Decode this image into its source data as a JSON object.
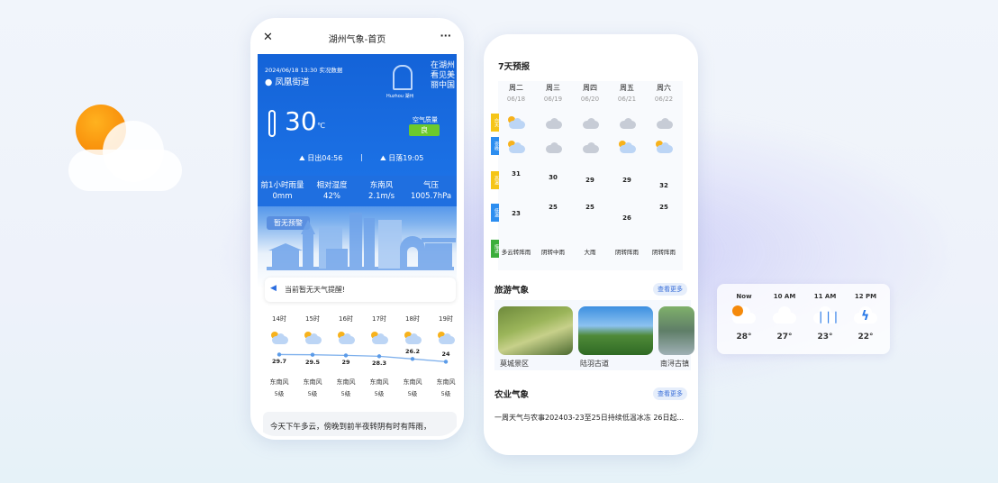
{
  "phone1": {
    "title": "湖州气象-首页",
    "close_icon": "close-icon",
    "more_icon": "more-icon",
    "timestamp": "2024/06/18 13:30 实况数据",
    "location": "凤凰街道",
    "logo_text": "Huzhou 湖州",
    "temperature": "30",
    "temp_unit": "℃",
    "aqi_label": "空气质量",
    "aqi_value": "良",
    "aqi_color": "#6cc92c",
    "sunrise": "日出04:56",
    "sunset": "日落19:05",
    "separator": "|",
    "stats": [
      {
        "label": "前1小时雨量",
        "value": "0mm"
      },
      {
        "label": "相对湿度",
        "value": "42%"
      },
      {
        "label": "东南风",
        "value": "2.1m/s"
      },
      {
        "label": "气压",
        "value": "1005.7hPa"
      }
    ],
    "warning_badge": "暂无预警",
    "notice": "当前暂无天气提醒!",
    "hourly": [
      {
        "time": "14时",
        "temp": 29.7,
        "temp_label": "29.7",
        "wind": "东南风",
        "level": "5级"
      },
      {
        "time": "15时",
        "temp": 29.5,
        "temp_label": "29.5",
        "wind": "东南风",
        "level": "5级"
      },
      {
        "time": "16时",
        "temp": 29,
        "temp_label": "29",
        "wind": "东南风",
        "level": "5级"
      },
      {
        "time": "17时",
        "temp": 28.3,
        "temp_label": "28.3",
        "wind": "东南风",
        "level": "5级"
      },
      {
        "time": "18时",
        "temp": 26.2,
        "temp_label": "26.2",
        "wind": "东南风",
        "level": "5级"
      },
      {
        "time": "19时",
        "temp": 24,
        "temp_label": "24",
        "wind": "东南风",
        "level": "5级"
      }
    ],
    "summary": "今天下午多云，傍晚到前半夜转阴有时有阵雨，"
  },
  "phone2": {
    "forecast_title": "7天预报",
    "row_labels": [
      "白天",
      "夜晚",
      "高温",
      "低温",
      "描述"
    ],
    "row_colors": [
      "#f5c518",
      "#2d8ef0",
      "#f5c518",
      "#2d8ef0",
      "#3cae3c"
    ],
    "days": [
      {
        "day": "周二",
        "date": "06/18",
        "high": 31,
        "low": 23,
        "desc": "多云转阵雨"
      },
      {
        "day": "周三",
        "date": "06/19",
        "high": 30,
        "low": 25,
        "desc": "阴转中雨"
      },
      {
        "day": "周四",
        "date": "06/20",
        "high": 29,
        "low": 25,
        "desc": "大雨"
      },
      {
        "day": "周五",
        "date": "06/21",
        "high": 29,
        "low": 26,
        "desc": "阴转阵雨"
      },
      {
        "day": "周六",
        "date": "06/22",
        "high": 32,
        "low": 25,
        "desc": "阴转阵雨"
      }
    ],
    "tourism_title": "旅游气象",
    "more_label": "查看更多",
    "spots": [
      "莫城景区",
      "陆羽古道",
      "南浔古镇"
    ],
    "agri_title": "农业气象",
    "agri_text": "一周天气与农事202403-23至25日持续低温冰冻 26日起..."
  },
  "widget": {
    "items": [
      {
        "time": "Now",
        "temp": "28°",
        "icon": "sun-cloud-icon"
      },
      {
        "time": "10 AM",
        "temp": "27°",
        "icon": "cloud-icon"
      },
      {
        "time": "11 AM",
        "temp": "23°",
        "icon": "rain-icon"
      },
      {
        "time": "12 PM",
        "temp": "22°",
        "icon": "thunder-icon"
      }
    ]
  }
}
